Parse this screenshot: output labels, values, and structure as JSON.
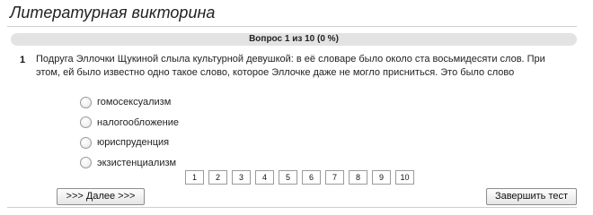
{
  "quiz": {
    "title": "Литературная викторина",
    "progress_text": "Вопрос 1 из 10   (0 %)",
    "progress_fraction": 0.0
  },
  "question": {
    "number": "1",
    "text": "Подруга Эллочки Щукиной слыла культурной девушкой: в её словаре было около ста восьмидесяти слов. При этом, ей было известно одно такое слово, которое Эллочке даже не могло присниться. Это было слово",
    "answers": [
      "гомосексуализм",
      "налогообложение",
      "юриспруденция",
      "экзистенциализм"
    ]
  },
  "pager": {
    "pages": [
      "1",
      "2",
      "3",
      "4",
      "5",
      "6",
      "7",
      "8",
      "9",
      "10"
    ]
  },
  "buttons": {
    "next_label": ">>> Далее >>>",
    "finish_label": "Завершить тест"
  }
}
